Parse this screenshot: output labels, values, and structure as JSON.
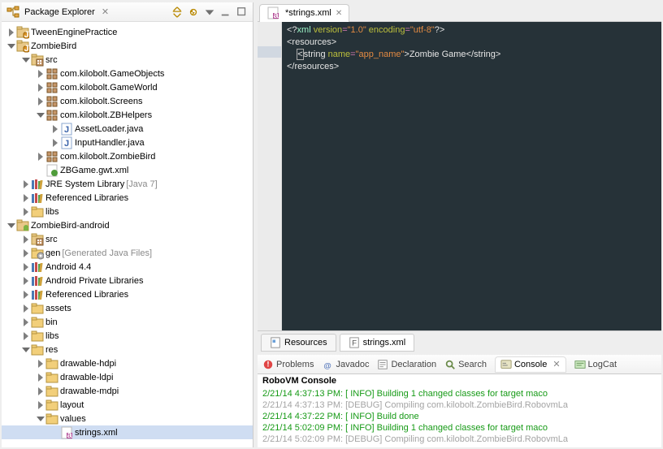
{
  "leftPanel": {
    "title": "Package Explorer"
  },
  "tree": {
    "items": [
      {
        "indent": 0,
        "arrow": "right",
        "icon": "project",
        "label": "TweenEnginePractice"
      },
      {
        "indent": 0,
        "arrow": "down",
        "icon": "project",
        "label": "ZombieBird"
      },
      {
        "indent": 1,
        "arrow": "down",
        "icon": "srcfolder",
        "label": "src"
      },
      {
        "indent": 2,
        "arrow": "right",
        "icon": "package",
        "label": "com.kilobolt.GameObjects"
      },
      {
        "indent": 2,
        "arrow": "right",
        "icon": "package",
        "label": "com.kilobolt.GameWorld"
      },
      {
        "indent": 2,
        "arrow": "right",
        "icon": "package",
        "label": "com.kilobolt.Screens"
      },
      {
        "indent": 2,
        "arrow": "down",
        "icon": "package",
        "label": "com.kilobolt.ZBHelpers"
      },
      {
        "indent": 3,
        "arrow": "right",
        "icon": "java",
        "label": "AssetLoader.java"
      },
      {
        "indent": 3,
        "arrow": "right",
        "icon": "java",
        "label": "InputHandler.java"
      },
      {
        "indent": 2,
        "arrow": "right",
        "icon": "package",
        "label": "com.kilobolt.ZombieBird"
      },
      {
        "indent": 2,
        "arrow": "none",
        "icon": "xmlfile",
        "label": "ZBGame.gwt.xml"
      },
      {
        "indent": 1,
        "arrow": "right",
        "icon": "library",
        "label": "JRE System Library",
        "decoration": "[Java 7]"
      },
      {
        "indent": 1,
        "arrow": "right",
        "icon": "library",
        "label": "Referenced Libraries"
      },
      {
        "indent": 1,
        "arrow": "right",
        "icon": "folder",
        "label": "libs"
      },
      {
        "indent": 0,
        "arrow": "down",
        "icon": "android-project",
        "label": "ZombieBird-android"
      },
      {
        "indent": 1,
        "arrow": "right",
        "icon": "srcfolder",
        "label": "src"
      },
      {
        "indent": 1,
        "arrow": "right",
        "icon": "genfolder",
        "label": "gen",
        "decoration": "[Generated Java Files]"
      },
      {
        "indent": 1,
        "arrow": "right",
        "icon": "library",
        "label": "Android 4.4"
      },
      {
        "indent": 1,
        "arrow": "right",
        "icon": "library",
        "label": "Android Private Libraries"
      },
      {
        "indent": 1,
        "arrow": "right",
        "icon": "library",
        "label": "Referenced Libraries"
      },
      {
        "indent": 1,
        "arrow": "right",
        "icon": "folder",
        "label": "assets"
      },
      {
        "indent": 1,
        "arrow": "right",
        "icon": "folder",
        "label": "bin"
      },
      {
        "indent": 1,
        "arrow": "right",
        "icon": "folder",
        "label": "libs"
      },
      {
        "indent": 1,
        "arrow": "down",
        "icon": "folder",
        "label": "res"
      },
      {
        "indent": 2,
        "arrow": "right",
        "icon": "folder",
        "label": "drawable-hdpi"
      },
      {
        "indent": 2,
        "arrow": "right",
        "icon": "folder",
        "label": "drawable-ldpi"
      },
      {
        "indent": 2,
        "arrow": "right",
        "icon": "folder",
        "label": "drawable-mdpi"
      },
      {
        "indent": 2,
        "arrow": "right",
        "icon": "folder",
        "label": "layout"
      },
      {
        "indent": 2,
        "arrow": "down",
        "icon": "folder",
        "label": "values"
      },
      {
        "indent": 3,
        "arrow": "none",
        "icon": "xmlfile-a",
        "label": "strings.xml",
        "selected": true
      }
    ]
  },
  "editor": {
    "tabLabel": "*strings.xml",
    "code": {
      "l1_a": "<?",
      "l1_b": "xml",
      "l1_c": " version",
      "l1_d": "=",
      "l1_e": "\"1.0\"",
      "l1_f": " encoding",
      "l1_g": "=",
      "l1_h": "\"utf-8\"",
      "l1_i": "?>",
      "l2": "<resources>",
      "l3_a": "    ",
      "l3_b": "<",
      "l3_c": "string",
      "l3_d": " name",
      "l3_e": "=",
      "l3_f": "\"app_name\"",
      "l3_g": ">",
      "l3_h": "Zombie Game",
      "l3_i": "</string>",
      "l4": "</resources>"
    },
    "bottomTabs": {
      "resources": "Resources",
      "stringsxml": "strings.xml"
    }
  },
  "console": {
    "tabs": {
      "problems": "Problems",
      "javadoc": "Javadoc",
      "declaration": "Declaration",
      "search": "Search",
      "console": "Console",
      "logcat": "LogCat"
    },
    "title": "RoboVM Console",
    "lines": [
      {
        "cls": "log-info",
        "text": "2/21/14 4:37:13 PM: [ INFO] Building 1 changed classes for target maco"
      },
      {
        "cls": "log-debug",
        "text": "2/21/14 4:37:13 PM: [DEBUG] Compiling com.kilobolt.ZombieBird.RobovmLa"
      },
      {
        "cls": "log-info",
        "text": "2/21/14 4:37:22 PM: [ INFO] Build done"
      },
      {
        "cls": "log-info",
        "text": "2/21/14 5:02:09 PM: [ INFO] Building 1 changed classes for target maco"
      },
      {
        "cls": "log-debug",
        "text": "2/21/14 5:02:09 PM: [DEBUG] Compiling com.kilobolt.ZombieBird.RobovmLa"
      }
    ]
  }
}
